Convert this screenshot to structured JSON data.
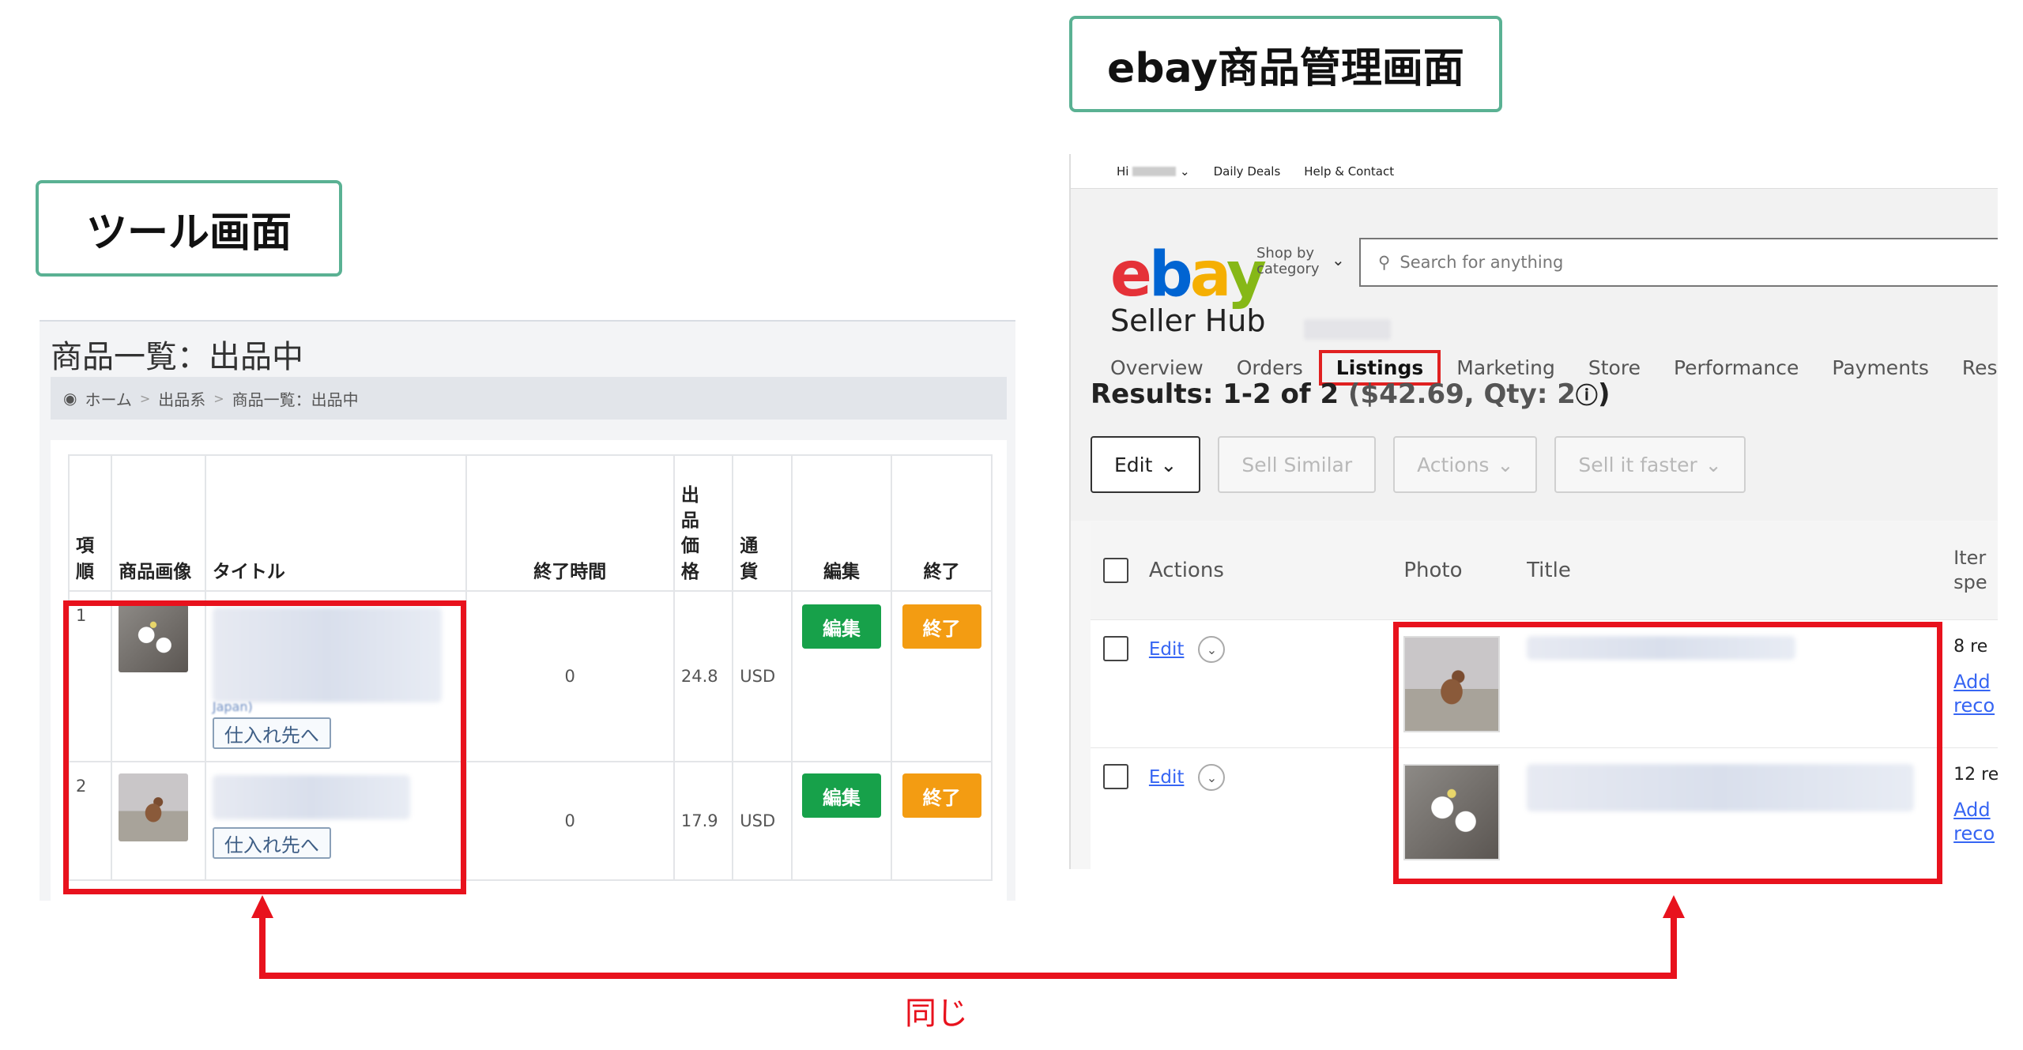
{
  "labels": {
    "tool": "ツール画面",
    "ebay": "ebay商品管理画面",
    "same": "同じ"
  },
  "tool": {
    "title": "商品一覧：出品中",
    "breadcrumb": [
      "ホーム",
      "出品系",
      "商品一覧：出品中"
    ],
    "columns": [
      "項順",
      "商品画像",
      "タイトル",
      "終了時間",
      "出品価格",
      "通貨",
      "編集",
      "終了"
    ],
    "rows": [
      {
        "num": "1",
        "end_time": "0",
        "price": "24.8",
        "currency": "USD",
        "edit": "編集",
        "end": "終了",
        "source": "仕入れ先へ",
        "title_fragment": "Japan)"
      },
      {
        "num": "2",
        "end_time": "0",
        "price": "17.9",
        "currency": "USD",
        "edit": "編集",
        "end": "終了",
        "source": "仕入れ先へ"
      }
    ]
  },
  "ebay": {
    "topbar": {
      "hi": "Hi",
      "daily": "Daily Deals",
      "help": "Help & Contact"
    },
    "shop_by": "Shop by",
    "category": "category",
    "search_placeholder": "Search for anything",
    "seller_hub": "Seller Hub",
    "tabs": [
      "Overview",
      "Orders",
      "Listings",
      "Marketing",
      "Store",
      "Performance",
      "Payments",
      "Res"
    ],
    "results_count": "Results: 1-2 of 2",
    "results_total": "($42.69, Qty: 2",
    "buttons": {
      "edit": "Edit",
      "sell_similar": "Sell Similar",
      "actions": "Actions",
      "sell_faster": "Sell it faster"
    },
    "columns": {
      "actions": "Actions",
      "photo": "Photo",
      "title": "Title",
      "spec_1": "Iter",
      "spec_2": "spe"
    },
    "rows": [
      {
        "edit": "Edit",
        "spec": "8 re",
        "add_1": "Add",
        "add_2": "reco"
      },
      {
        "edit": "Edit",
        "spec": "12 re",
        "add_1": "Add",
        "add_2": "reco"
      }
    ]
  },
  "colors": {
    "accent_green": "#5ab193",
    "highlight_red": "#e8121d",
    "btn_green": "#17a14a",
    "btn_orange": "#f39c12",
    "link_blue": "#3665f3"
  }
}
